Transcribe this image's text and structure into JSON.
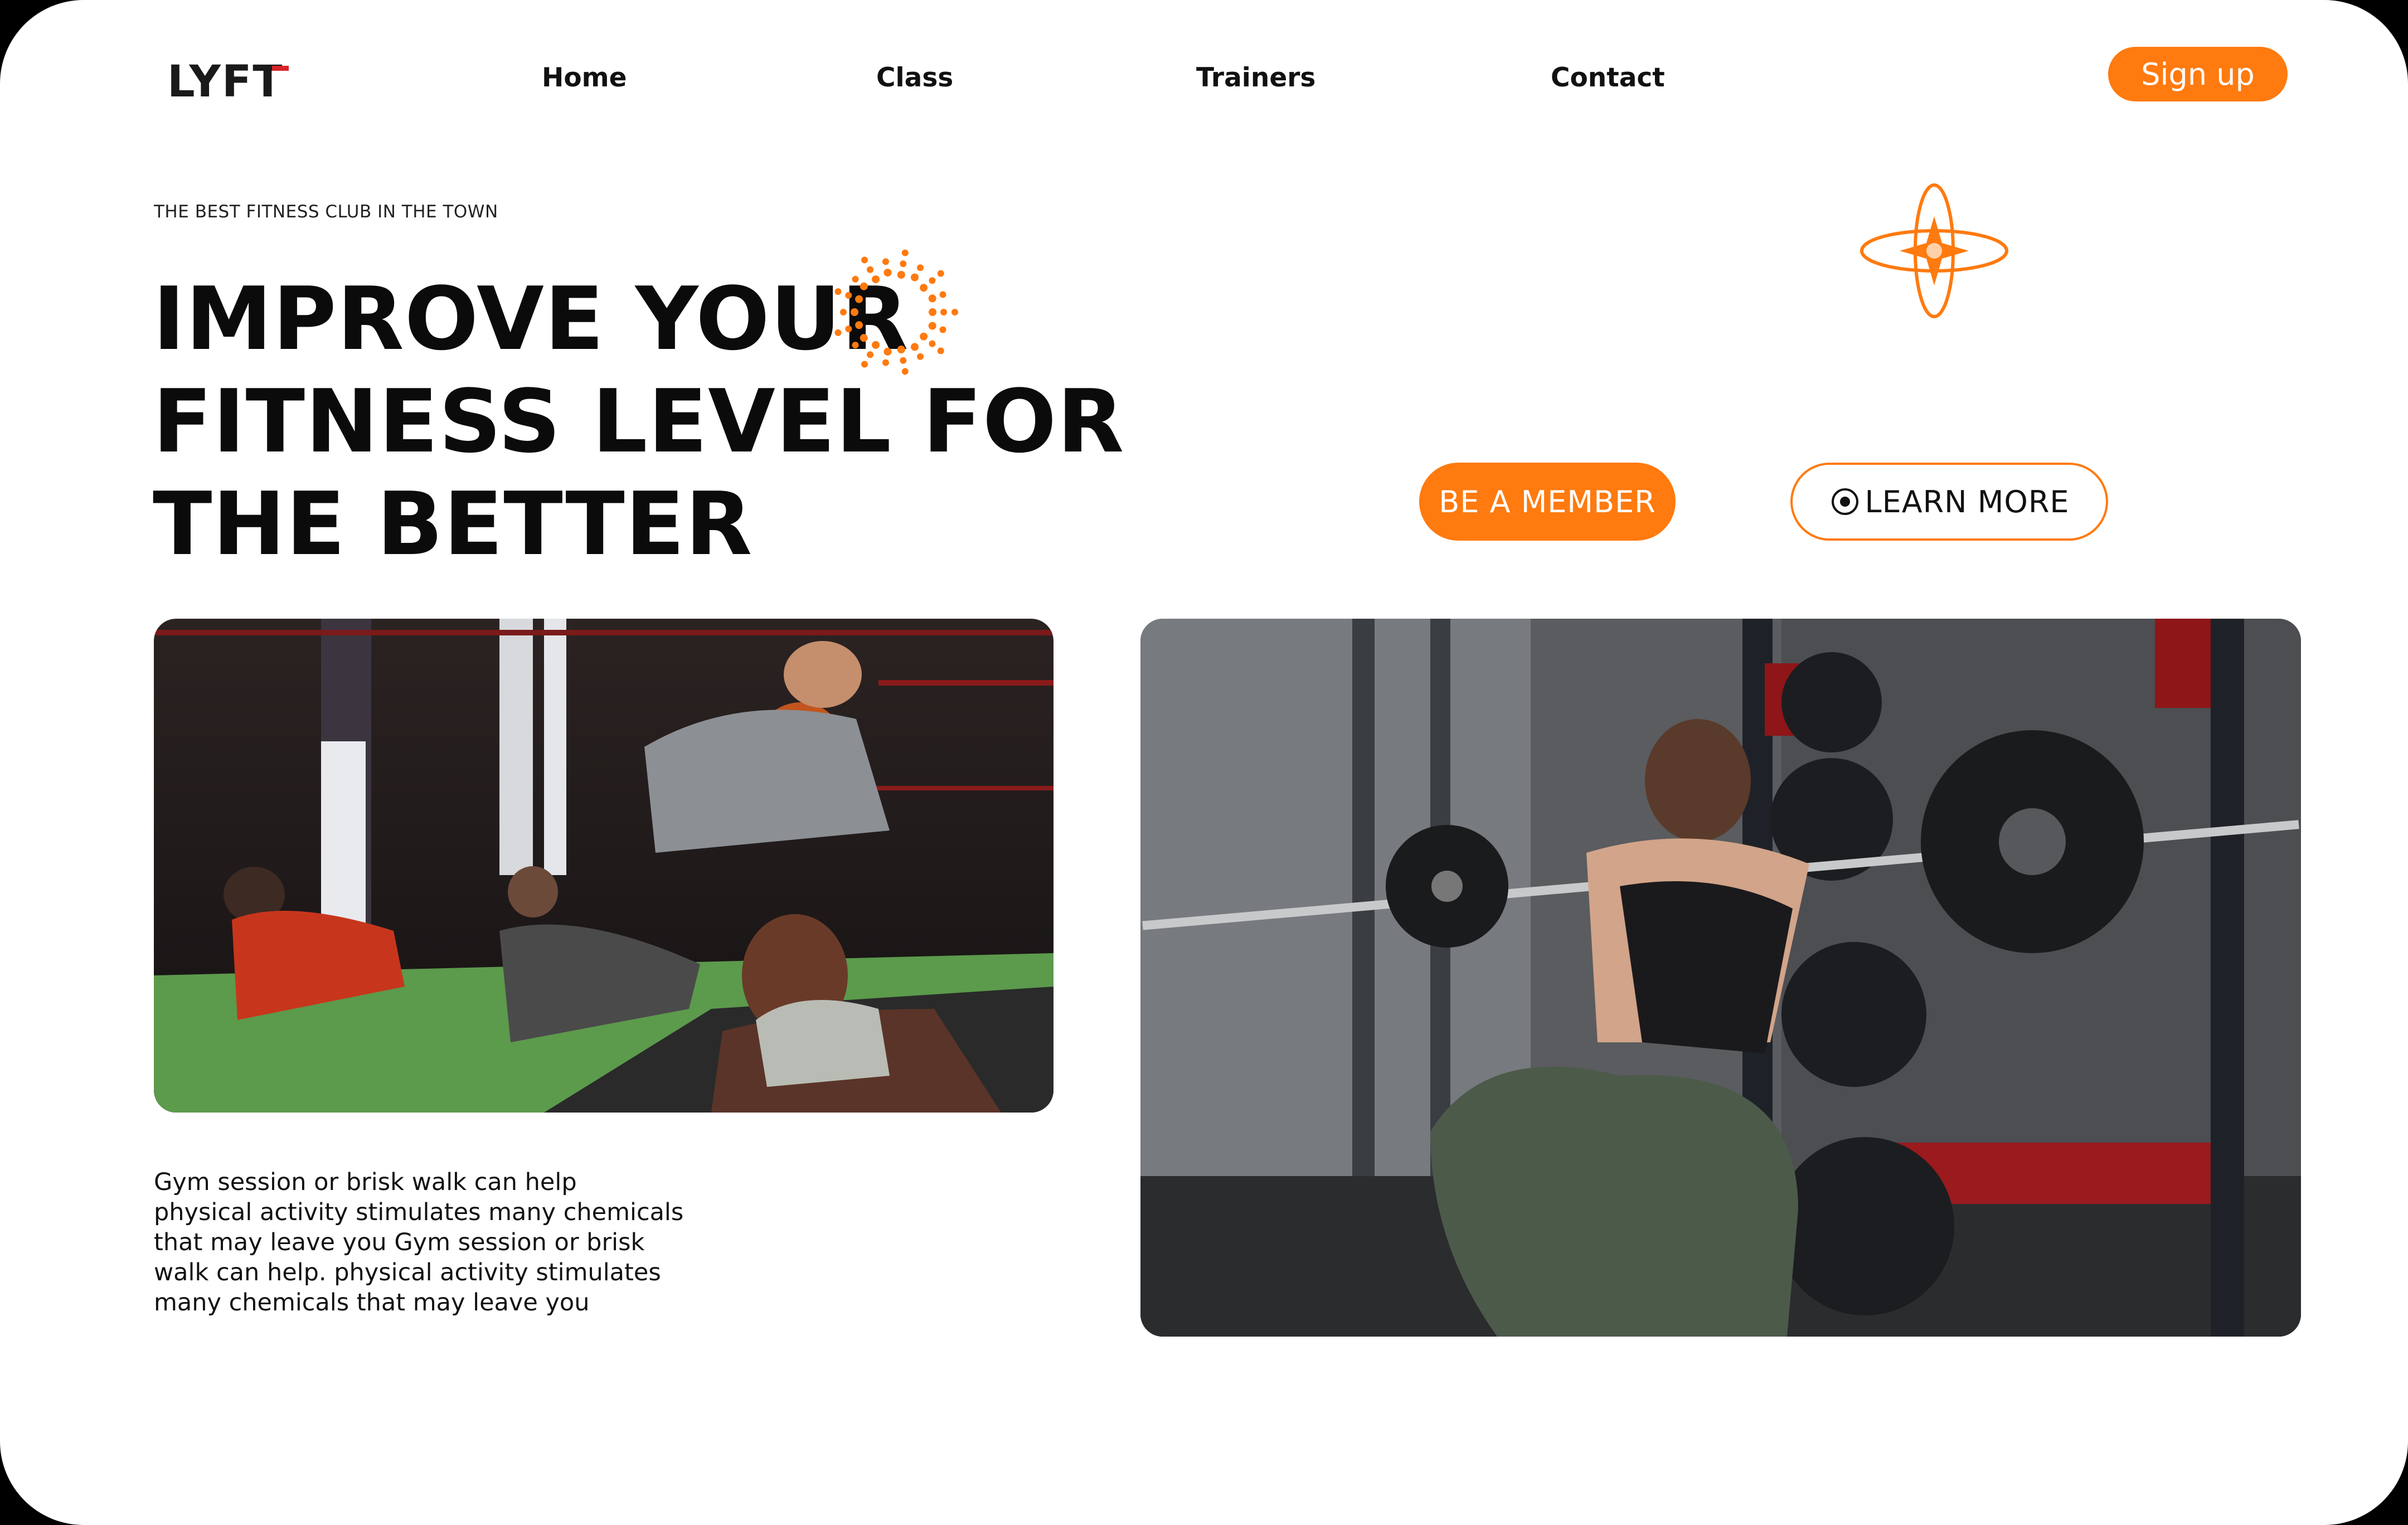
{
  "brand": {
    "logo_text": "LYFT",
    "accent_color": "#ff7a0f",
    "logo_mark_color": "#d8232a"
  },
  "nav": {
    "items": [
      {
        "label": "Home"
      },
      {
        "label": "Class"
      },
      {
        "label": "Trainers"
      },
      {
        "label": "Contact"
      }
    ],
    "signup_label": "Sign up"
  },
  "hero": {
    "tagline": "THE BEST FITNESS CLUB IN THE TOWN",
    "headline_lines": [
      "IMPROVE YOUR",
      "FITNESS LEVEL FOR",
      "THE BETTER"
    ],
    "primary_cta": "BE A MEMBER",
    "secondary_cta": "LEARN MORE",
    "secondary_cta_icon": "target-circle-icon",
    "decor_icons": [
      "sunburst-dots-icon",
      "orbit-star-icon"
    ]
  },
  "content": {
    "body_lines": [
      "Gym session or brisk walk can help",
      "physical activity stimulates many chemicals",
      "that may leave you Gym session or brisk",
      "walk can help. physical activity stimulates",
      "many chemicals that may leave you"
    ],
    "images": [
      {
        "name": "group-plank-class-photo"
      },
      {
        "name": "barbell-squat-photo"
      }
    ]
  }
}
